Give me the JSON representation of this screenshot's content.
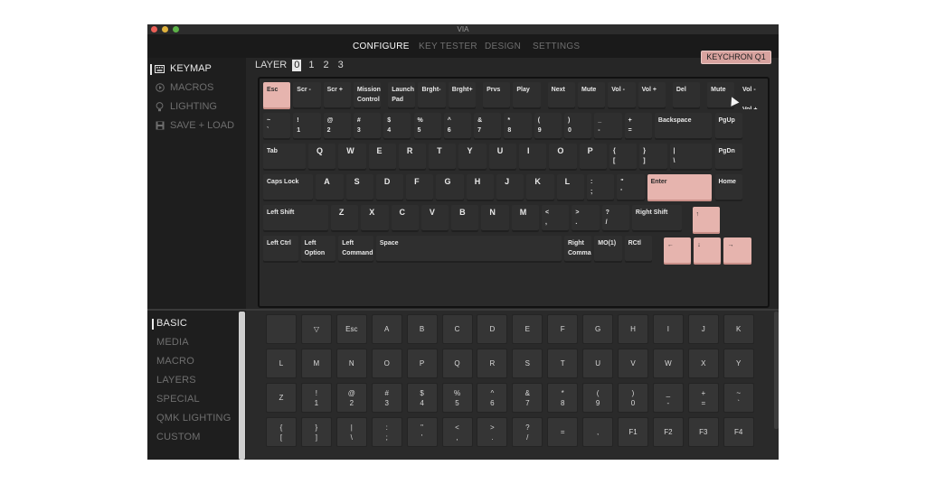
{
  "window": {
    "title": "VIA"
  },
  "topnav": {
    "tabs": [
      "CONFIGURE",
      "KEY TESTER",
      "DESIGN",
      "SETTINGS"
    ],
    "active": "CONFIGURE"
  },
  "sidebar": {
    "items": [
      {
        "label": "KEYMAP",
        "icon": "keyboard-icon",
        "active": true
      },
      {
        "label": "MACROS",
        "icon": "play-circle-icon",
        "active": false
      },
      {
        "label": "LIGHTING",
        "icon": "bulb-icon",
        "active": false
      },
      {
        "label": "SAVE + LOAD",
        "icon": "save-icon",
        "active": false
      }
    ]
  },
  "layers": {
    "label": "LAYER",
    "numbers": [
      "0",
      "1",
      "2",
      "3"
    ],
    "active": "0"
  },
  "keyboard_name": "KEYCHRON Q1",
  "keyboard": {
    "rows": [
      [
        {
          "label": "Esc",
          "pink": true
        },
        {
          "label": "Scr -"
        },
        {
          "label": "Scr +"
        },
        {
          "label": "Mission\nControl"
        },
        {
          "label": "Launch\nPad"
        },
        {
          "label": "Brght-"
        },
        {
          "label": "Brght+"
        },
        {
          "label": "Prvs"
        },
        {
          "label": "Play"
        },
        {
          "label": "Next"
        },
        {
          "label": "Mute"
        },
        {
          "label": "Vol -"
        },
        {
          "label": "Vol +"
        },
        {
          "label": "Del"
        },
        {
          "label": "Mute"
        }
      ],
      [
        {
          "label": "~\n`"
        },
        {
          "label": "!\n1"
        },
        {
          "label": "@\n2"
        },
        {
          "label": "#\n3"
        },
        {
          "label": "$\n4"
        },
        {
          "label": "%\n5"
        },
        {
          "label": "^\n6"
        },
        {
          "label": "&\n7"
        },
        {
          "label": "*\n8"
        },
        {
          "label": "(\n9"
        },
        {
          "label": ")\n0"
        },
        {
          "label": "_\n-"
        },
        {
          "label": "+\n="
        },
        {
          "label": "Backspace"
        },
        {
          "label": "PgUp"
        }
      ],
      [
        {
          "label": "Tab"
        },
        {
          "label": "Q",
          "letter": true
        },
        {
          "label": "W",
          "letter": true
        },
        {
          "label": "E",
          "letter": true
        },
        {
          "label": "R",
          "letter": true
        },
        {
          "label": "T",
          "letter": true
        },
        {
          "label": "Y",
          "letter": true
        },
        {
          "label": "U",
          "letter": true
        },
        {
          "label": "I",
          "letter": true
        },
        {
          "label": "O",
          "letter": true
        },
        {
          "label": "P",
          "letter": true
        },
        {
          "label": "{\n["
        },
        {
          "label": "}\n]"
        },
        {
          "label": "|\n\\"
        },
        {
          "label": "PgDn"
        }
      ],
      [
        {
          "label": "Caps Lock"
        },
        {
          "label": "A",
          "letter": true
        },
        {
          "label": "S",
          "letter": true
        },
        {
          "label": "D",
          "letter": true
        },
        {
          "label": "F",
          "letter": true
        },
        {
          "label": "G",
          "letter": true
        },
        {
          "label": "H",
          "letter": true
        },
        {
          "label": "J",
          "letter": true
        },
        {
          "label": "K",
          "letter": true
        },
        {
          "label": "L",
          "letter": true
        },
        {
          "label": ":\n;"
        },
        {
          "label": "\"\n'"
        },
        {
          "label": "Enter",
          "pink": true
        },
        {
          "label": "Home"
        }
      ],
      [
        {
          "label": "Left Shift"
        },
        {
          "label": "Z",
          "letter": true
        },
        {
          "label": "X",
          "letter": true
        },
        {
          "label": "C",
          "letter": true
        },
        {
          "label": "V",
          "letter": true
        },
        {
          "label": "B",
          "letter": true
        },
        {
          "label": "N",
          "letter": true
        },
        {
          "label": "M",
          "letter": true
        },
        {
          "label": "<\n,"
        },
        {
          "label": ">\n."
        },
        {
          "label": "?\n/"
        },
        {
          "label": "Right Shift"
        },
        {
          "label": "↑",
          "pink": true
        }
      ],
      [
        {
          "label": "Left Ctrl"
        },
        {
          "label": "Left\nOption"
        },
        {
          "label": "Left\nCommand"
        },
        {
          "label": "Space"
        },
        {
          "label": "Right\nComma"
        },
        {
          "label": "MO(1)"
        },
        {
          "label": "RCtl"
        },
        {
          "label": "←",
          "pink": true
        },
        {
          "label": "↓",
          "pink": true
        },
        {
          "label": "→",
          "pink": true
        }
      ]
    ],
    "knob": {
      "label": "Vol -",
      "label2": "Vol +"
    }
  },
  "categories": {
    "items": [
      "BASIC",
      "MEDIA",
      "MACRO",
      "LAYERS",
      "SPECIAL",
      "QMK LIGHTING",
      "CUSTOM"
    ],
    "active": "BASIC"
  },
  "picker_keys": [
    [
      "",
      "▽",
      "Esc",
      "A",
      "B",
      "C",
      "D",
      "E",
      "F",
      "G",
      "H",
      "I",
      "J",
      "K"
    ],
    [
      "L",
      "M",
      "N",
      "O",
      "P",
      "Q",
      "R",
      "S",
      "T",
      "U",
      "V",
      "W",
      "X",
      "Y"
    ],
    [
      "Z",
      "!\n1",
      "@\n2",
      "#\n3",
      "$\n4",
      "%\n5",
      "^\n6",
      "&\n7",
      "*\n8",
      "(\n9",
      ")\n0",
      "_\n-",
      "+\n=",
      "~\n`"
    ],
    [
      "{\n[",
      "}\n]",
      "|\n\\",
      ":\n;",
      "\"\n'",
      "<\n,",
      ">\n.",
      "?\n/",
      "=",
      ",",
      "F1",
      "F2",
      "F3",
      "F4"
    ]
  ]
}
